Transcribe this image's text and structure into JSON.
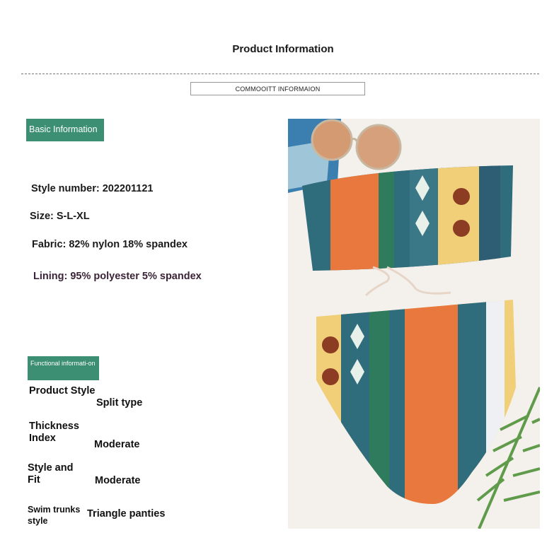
{
  "header": {
    "title": "Product Information",
    "subtitle": "COMMOOITT INFORMAION"
  },
  "basic": {
    "badge": "Basic Information",
    "style_number": "Style number: 202201121",
    "size": "Size: S-L-XL",
    "fabric": "Fabric: 82% nylon 18% spandex",
    "lining": "Lining: 95% polyester 5% spandex"
  },
  "functional": {
    "badge": "Functional informati-on",
    "rows": [
      {
        "label": "Product Style",
        "value": "Split type"
      },
      {
        "label": "Thickness Index",
        "value": "Moderate"
      },
      {
        "label": "Style and Fit",
        "value": "Moderate"
      },
      {
        "label": "Swim trunks style",
        "value": "Triangle panties"
      }
    ]
  },
  "photo": {
    "description_icon": "bikini-photo",
    "colors": {
      "orange": "#e9783e",
      "teal": "#2f6c7c",
      "green": "#2f7b5d",
      "yellow": "#f1cf79",
      "bg": "#f4f1ec"
    }
  }
}
